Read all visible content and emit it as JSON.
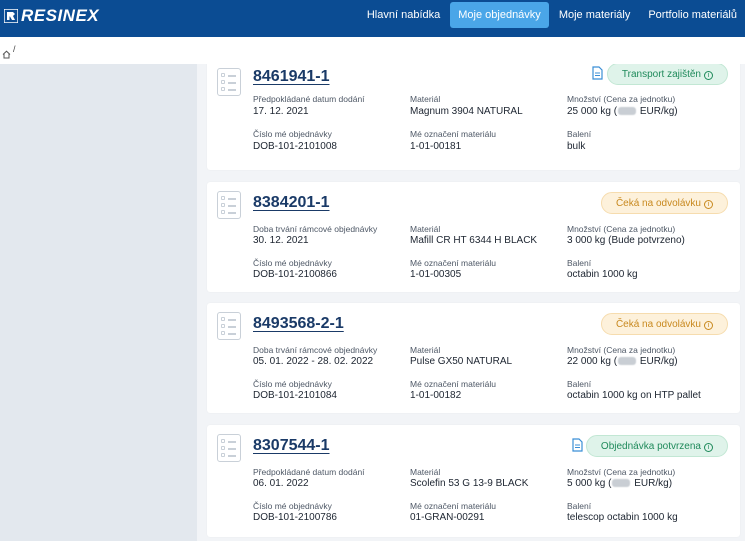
{
  "brand": {
    "name": "RESINEX"
  },
  "nav": {
    "items": [
      {
        "label": "Hlavní nabídka",
        "active": false
      },
      {
        "label": "Moje objednávky",
        "active": true
      },
      {
        "label": "Moje materiály",
        "active": false
      },
      {
        "label": "Portfolio materiálů",
        "active": false
      }
    ]
  },
  "breadcrumb": {
    "separator": "/"
  },
  "orders": [
    {
      "number": "8461941-1",
      "has_document": true,
      "status": {
        "label": "Transport zajištěn",
        "tone": "green"
      },
      "date_label": "Předpokládané datum dodání",
      "date_value": "17. 12. 2021",
      "material_label": "Materiál",
      "material_value": "Magnum 3904 NATURAL",
      "qty_label": "Množství (Cena za jednotku)",
      "qty_before": "25 000 kg (",
      "qty_hidden": true,
      "qty_after": " EUR/kg)",
      "myorder_label": "Číslo mé objednávky",
      "myorder_value": "DOB-101-2101008",
      "mymark_label": "Mé označení materiálu",
      "mymark_value": "1-01-00181",
      "pack_label": "Balení",
      "pack_value": "bulk"
    },
    {
      "number": "8384201-1",
      "has_document": false,
      "status": {
        "label": "Čeká na odvolávku",
        "tone": "yellow"
      },
      "date_label": "Doba trvání rámcové objednávky",
      "date_value": "30. 12. 2021",
      "material_label": "Materiál",
      "material_value": "Mafill CR HT 6344 H BLACK",
      "qty_label": "Množství (Cena za jednotku)",
      "qty_before": "3 000 kg (Bude potvrzeno)",
      "qty_hidden": false,
      "qty_after": "",
      "myorder_label": "Číslo mé objednávky",
      "myorder_value": "DOB-101-2100866",
      "mymark_label": "Mé označení materiálu",
      "mymark_value": "1-01-00305",
      "pack_label": "Balení",
      "pack_value": "octabin 1000 kg"
    },
    {
      "number": "8493568-2-1",
      "has_document": false,
      "status": {
        "label": "Čeká na odvolávku",
        "tone": "yellow"
      },
      "date_label": "Doba trvání rámcové objednávky",
      "date_value": "05. 01. 2022 - 28. 02. 2022",
      "material_label": "Materiál",
      "material_value": "Pulse GX50 NATURAL",
      "qty_label": "Množství (Cena za jednotku)",
      "qty_before": "22 000 kg (",
      "qty_hidden": true,
      "qty_after": " EUR/kg)",
      "myorder_label": "Číslo mé objednávky",
      "myorder_value": "DOB-101-2101084",
      "mymark_label": "Mé označení materiálu",
      "mymark_value": "1-01-00182",
      "pack_label": "Balení",
      "pack_value": "octabin 1000 kg on HTP pallet"
    },
    {
      "number": "8307544-1",
      "has_document": true,
      "status": {
        "label": "Objednávka potvrzena",
        "tone": "green"
      },
      "date_label": "Předpokládané datum dodání",
      "date_value": "06. 01. 2022",
      "material_label": "Materiál",
      "material_value": "Scolefin 53 G 13-9 BLACK",
      "qty_label": "Množství (Cena za jednotku)",
      "qty_before": "5 000 kg (",
      "qty_hidden": true,
      "qty_after": " EUR/kg)",
      "myorder_label": "Číslo mé objednávky",
      "myorder_value": "DOB-101-2100786",
      "mymark_label": "Mé označení materiálu",
      "mymark_value": "01-GRAN-00291",
      "pack_label": "Balení",
      "pack_value": "telescop octabin 1000 kg"
    }
  ]
}
